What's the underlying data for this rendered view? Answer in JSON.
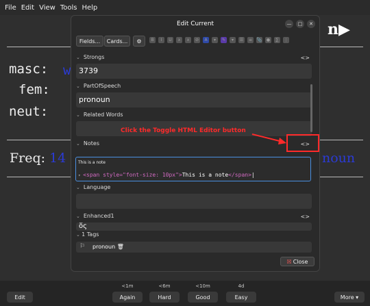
{
  "menu": [
    "File",
    "Edit",
    "View",
    "Tools",
    "Help"
  ],
  "background": {
    "masc_label": "masc:",
    "masc_value": "w",
    "fem_label": "fem:",
    "neut_label": "neut:",
    "freq_label": "Freq:",
    "freq_value": "14",
    "freq_word": "noun"
  },
  "dialog": {
    "title": "Edit Current",
    "fields_button": "Fields...",
    "cards_button": "Cards...",
    "fields": [
      {
        "label": "Strongs",
        "value": "3739"
      },
      {
        "label": "PartOfSpeech",
        "value": "pronoun"
      },
      {
        "label": "Related Words",
        "value": ""
      },
      {
        "label": "Notes",
        "preview": "This is a note",
        "html_value": ""
      },
      {
        "label": "Language",
        "value": ""
      },
      {
        "label": "Enhanced1",
        "value": "ὅς"
      }
    ],
    "html_code": {
      "open_tag": "<span style=\"font-size: 10px\">",
      "text": "This is a note",
      "close_tag": "</span>"
    },
    "toggle_symbol": "<>",
    "tags_label": "1 Tags",
    "tag": "pronoun",
    "close_button": "Close"
  },
  "annotation": "Click the Toggle HTML Editor button",
  "review": {
    "edit_button": "Edit",
    "more_button": "More ▾",
    "answers": [
      {
        "due": "<1m",
        "label": "Again"
      },
      {
        "due": "<6m",
        "label": "Hard"
      },
      {
        "due": "<10m",
        "label": "Good"
      },
      {
        "due": "4d",
        "label": "Easy"
      }
    ]
  },
  "colors": {
    "accent_focus": "#4a90e2",
    "annotation_red": "#ff2a2a",
    "tag_pink": "#d36ac2",
    "attr_gold": "#e8c84a"
  }
}
